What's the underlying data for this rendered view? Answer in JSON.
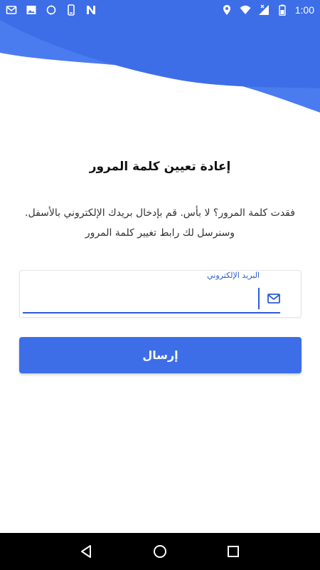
{
  "status_bar": {
    "time": "1:00",
    "left_icons": [
      "mail-icon",
      "image-icon",
      "sync-icon",
      "phone-icon",
      "n-icon"
    ],
    "right_icons": [
      "location-icon",
      "wifi-icon",
      "signal-icon",
      "battery-icon"
    ]
  },
  "colors": {
    "primary": "#3d6ee8",
    "accent": "#2d5bd6",
    "wave_light": "#4a7cf0"
  },
  "page": {
    "title": "إعادة تعيين كلمة المرور",
    "description_line1": "فقدت كلمة المرور؟ لا بأس. قم بإدخال بريدك الإلكتروني بالأسفل.",
    "description_line2": "وسنرسل لك رابط تغيير كلمة المرور"
  },
  "email_field": {
    "label": "البريد الإلكتروني",
    "value": "",
    "icon": "mail-icon"
  },
  "submit_button": {
    "label": "إرسال"
  },
  "nav_bar": {
    "icons": [
      "back-icon",
      "home-icon",
      "recents-icon"
    ]
  }
}
